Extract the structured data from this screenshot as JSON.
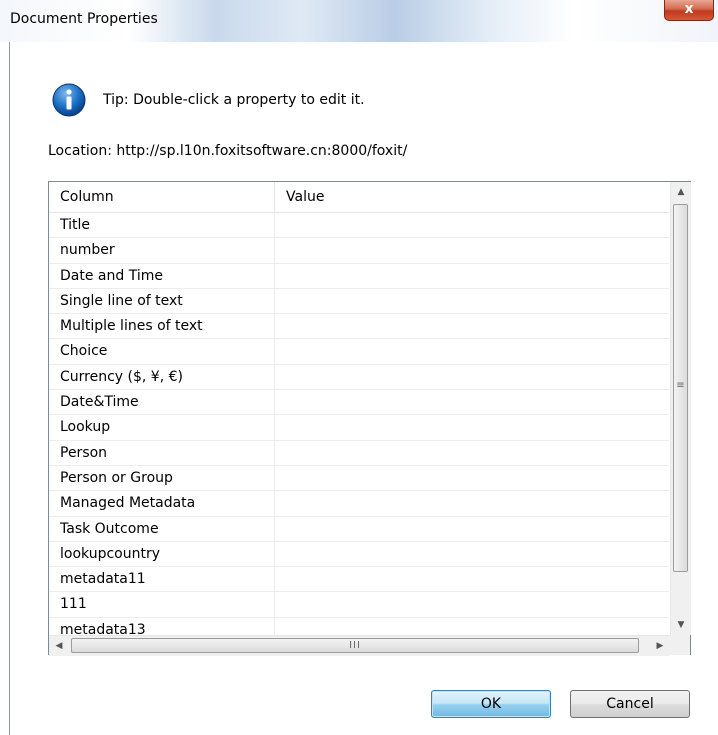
{
  "dialog": {
    "title": "Document Properties",
    "close_label": "x"
  },
  "tip": {
    "icon": "info-icon",
    "text": "Tip: Double-click a property to edit it."
  },
  "location": {
    "text": "Location: http://sp.l10n.foxitsoftware.cn:8000/foxit/"
  },
  "table": {
    "columns": [
      "Column",
      "Value"
    ],
    "rows": [
      {
        "column": "Title",
        "value": ""
      },
      {
        "column": "number",
        "value": ""
      },
      {
        "column": "Date and Time",
        "value": ""
      },
      {
        "column": "Single line of text",
        "value": ""
      },
      {
        "column": "Multiple lines of text",
        "value": ""
      },
      {
        "column": "Choice",
        "value": ""
      },
      {
        "column": "Currency ($, ¥, €)",
        "value": ""
      },
      {
        "column": "Date&Time",
        "value": ""
      },
      {
        "column": "Lookup",
        "value": ""
      },
      {
        "column": "Person",
        "value": ""
      },
      {
        "column": "Person or Group",
        "value": ""
      },
      {
        "column": "Managed Metadata",
        "value": ""
      },
      {
        "column": "Task Outcome",
        "value": ""
      },
      {
        "column": "lookupcountry",
        "value": ""
      },
      {
        "column": "metadata11",
        "value": ""
      },
      {
        "column": "111",
        "value": ""
      },
      {
        "column": "metadata13",
        "value": ""
      }
    ]
  },
  "buttons": {
    "ok_label": "OK",
    "cancel_label": "Cancel"
  },
  "colors": {
    "accent": "#1a6fc4",
    "close_button": "#c4381e"
  }
}
